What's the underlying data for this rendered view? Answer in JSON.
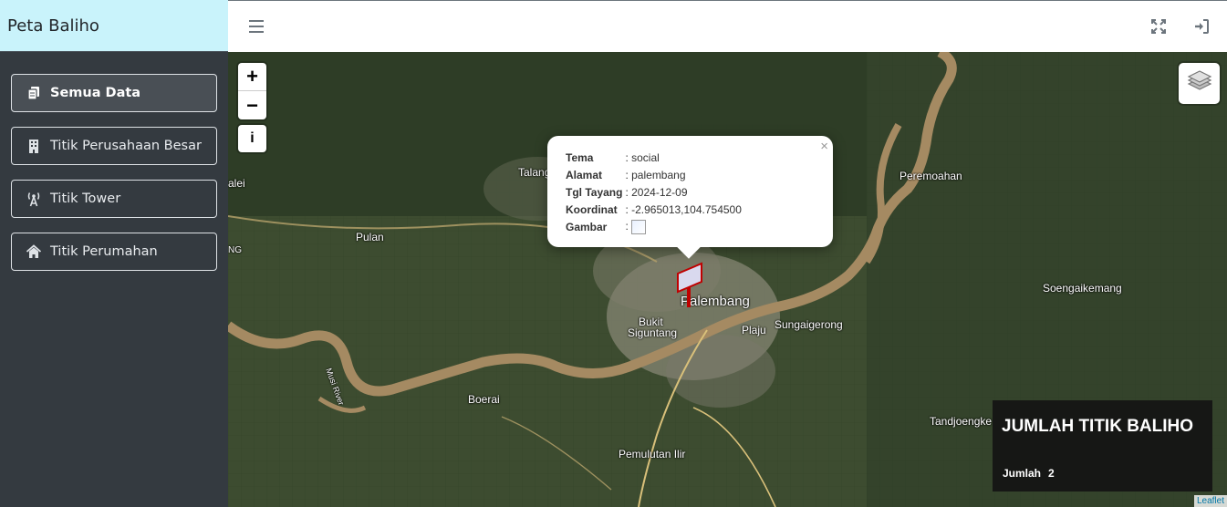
{
  "app": {
    "title": "Peta Baliho"
  },
  "sidebar": {
    "items": [
      {
        "label": "Semua Data",
        "icon": "copy-icon",
        "active": true
      },
      {
        "label": "Titik Perusahaan Besar",
        "icon": "building-icon",
        "active": false
      },
      {
        "label": "Titik Tower",
        "icon": "tower-broadcast-icon",
        "active": false
      },
      {
        "label": "Titik Perumahan",
        "icon": "home-icon",
        "active": false
      }
    ]
  },
  "header": {
    "menu_icon": "hamburger-icon",
    "fullscreen_icon": "expand-icon",
    "login_icon": "sign-in-icon"
  },
  "map": {
    "zoom_in": "+",
    "zoom_out": "−",
    "info": "i",
    "places": [
      "Talang",
      "alei",
      "Pulan",
      "NG",
      "Palembang",
      "Bukit",
      "Siguntang",
      "Plaju",
      "Sungaigerong",
      "Musi River",
      "Boerai",
      "Pemulutan Ilir",
      "Peremoahan",
      "Soengaikemang",
      "Tandjoengke"
    ],
    "attribution": "Leaflet"
  },
  "popup": {
    "rows": [
      {
        "key": "Tema",
        "value": "social"
      },
      {
        "key": "Alamat",
        "value": "palembang"
      },
      {
        "key": "Tgl Tayang",
        "value": "2024-12-09"
      },
      {
        "key": "Koordinat",
        "value": "-2.965013,104.754500"
      },
      {
        "key": "Gambar",
        "value": ""
      }
    ],
    "close": "×"
  },
  "counter": {
    "title": "JUMLAH TITIK BALIHO",
    "label": "Jumlah",
    "value": "2"
  },
  "colors": {
    "brand_bg": "#c9f3fb",
    "sidebar_bg": "#343a40",
    "marker": "#c00000"
  }
}
